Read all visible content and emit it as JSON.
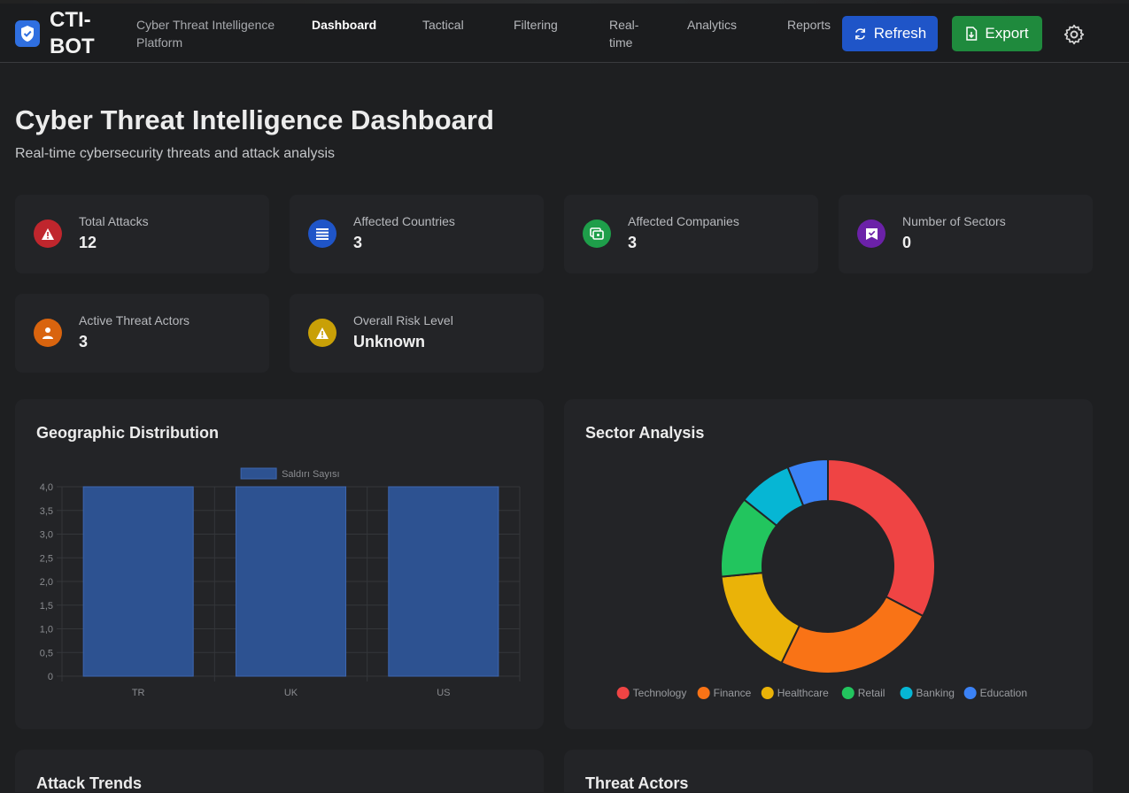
{
  "header": {
    "brand": "CTI-BOT",
    "platform": "Cyber Threat Intelligence Platform",
    "nav": [
      {
        "label": "Dashboard",
        "active": true
      },
      {
        "label": "Tactical",
        "active": false
      },
      {
        "label": "Filtering",
        "active": false
      },
      {
        "label": "Real-time",
        "active": false
      },
      {
        "label": "Analytics",
        "active": false
      },
      {
        "label": "Reports",
        "active": false
      }
    ],
    "refresh_label": "Refresh",
    "export_label": "Export"
  },
  "page": {
    "title": "Cyber Threat Intelligence Dashboard",
    "subtitle": "Real-time cybersecurity threats and attack analysis"
  },
  "stats": [
    {
      "label": "Total Attacks",
      "value": "12",
      "icon": "warning-icon",
      "color": "#c0262d"
    },
    {
      "label": "Affected Countries",
      "value": "3",
      "icon": "list-icon",
      "color": "#1f55c8"
    },
    {
      "label": "Affected Companies",
      "value": "3",
      "icon": "companies-icon",
      "color": "#1e9e4a"
    },
    {
      "label": "Number of Sectors",
      "value": "0",
      "icon": "sector-icon",
      "color": "#6b21a8"
    },
    {
      "label": "Active Threat Actors",
      "value": "3",
      "icon": "user-icon",
      "color": "#d9640e"
    },
    {
      "label": "Overall Risk Level",
      "value": "Unknown",
      "icon": "risk-icon",
      "color": "#c9a007"
    }
  ],
  "cards": {
    "geo_title": "Geographic Distribution",
    "sector_title": "Sector Analysis",
    "trends_title": "Attack Trends",
    "actors_title": "Threat Actors"
  },
  "chart_data": [
    {
      "type": "bar",
      "categories": [
        "TR",
        "UK",
        "US"
      ],
      "series": [
        {
          "name": "Saldırı Sayısı",
          "values": [
            4,
            4,
            4
          ],
          "color": "#2d5291"
        }
      ],
      "ylim": [
        0,
        4
      ],
      "yticks": [
        "0",
        "0,5",
        "1,0",
        "1,5",
        "2,0",
        "2,5",
        "3,0",
        "3,5",
        "4,0"
      ],
      "legend": "top",
      "grid": true
    },
    {
      "type": "pie",
      "donut": true,
      "categories": [
        "Technology",
        "Finance",
        "Healthcare",
        "Retail",
        "Banking",
        "Education"
      ],
      "values": [
        4,
        3,
        2,
        1.5,
        1,
        0.75
      ],
      "colors": [
        "#ef4444",
        "#f97316",
        "#eab308",
        "#22c55e",
        "#06b6d4",
        "#3b82f6"
      ],
      "legend": "bottom"
    }
  ]
}
